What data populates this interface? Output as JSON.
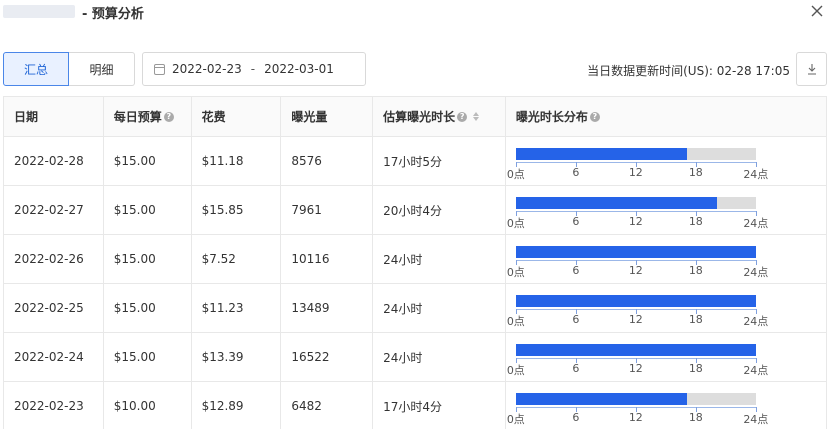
{
  "header": {
    "title": "- 预算分析"
  },
  "toolbar": {
    "tabs": [
      {
        "label": "汇总",
        "active": true
      },
      {
        "label": "明细",
        "active": false
      }
    ],
    "date_start": "2022-02-23",
    "date_sep": "-",
    "date_end": "2022-03-01",
    "update_time": "当日数据更新时间(US): 02-28 17:05"
  },
  "table": {
    "columns": [
      "日期",
      "每日预算",
      "花费",
      "曝光量",
      "估算曝光时长",
      "曝光时长分布"
    ],
    "axis_ticks": [
      "0点",
      "6",
      "12",
      "18",
      "24点"
    ],
    "rows": [
      {
        "date": "2022-02-28",
        "budget": "$15.00",
        "spend": "$11.18",
        "impressions": "8576",
        "duration": "17小时5分",
        "hours": 17.08
      },
      {
        "date": "2022-02-27",
        "budget": "$15.00",
        "spend": "$15.85",
        "impressions": "7961",
        "duration": "20小时4分",
        "hours": 20.07
      },
      {
        "date": "2022-02-26",
        "budget": "$15.00",
        "spend": "$7.52",
        "impressions": "10116",
        "duration": "24小时",
        "hours": 24
      },
      {
        "date": "2022-02-25",
        "budget": "$15.00",
        "spend": "$11.23",
        "impressions": "13489",
        "duration": "24小时",
        "hours": 24
      },
      {
        "date": "2022-02-24",
        "budget": "$15.00",
        "spend": "$13.39",
        "impressions": "16522",
        "duration": "24小时",
        "hours": 24
      },
      {
        "date": "2022-02-23",
        "budget": "$10.00",
        "spend": "$12.89",
        "impressions": "6482",
        "duration": "17小时4分",
        "hours": 17.07
      }
    ]
  },
  "colors": {
    "accent": "#2563e8",
    "track": "#dddddd"
  }
}
